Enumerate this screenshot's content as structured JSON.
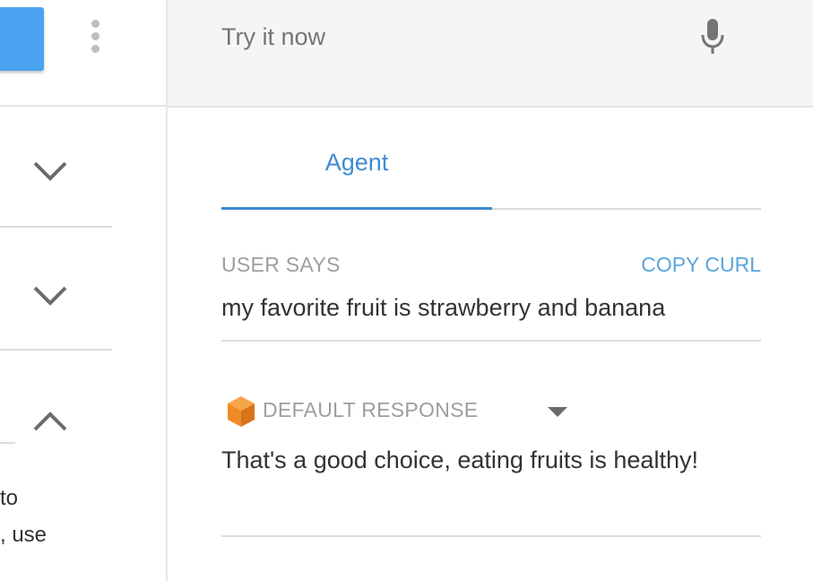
{
  "left_panel": {
    "text_line1": "to",
    "text_line2": ", use"
  },
  "test_console": {
    "input_placeholder": "Try it now",
    "tab_agent": "Agent",
    "user_says_label": "USER SAYS",
    "copy_curl_label": "COPY CURL",
    "user_query": "my favorite fruit is strawberry and banana",
    "default_response_label": "DEFAULT RESPONSE",
    "response_text": "That's a good choice, eating fruits is healthy!"
  },
  "colors": {
    "accent_blue": "#3d8ccf",
    "link_blue": "#5aa6dc",
    "button_blue": "#4aa3f0",
    "cube_orange": "#f08a24"
  },
  "icons": [
    "kebab-menu-icon",
    "microphone-icon",
    "chevron-down-icon",
    "chevron-up-icon",
    "cube-icon",
    "dropdown-triangle-icon"
  ]
}
